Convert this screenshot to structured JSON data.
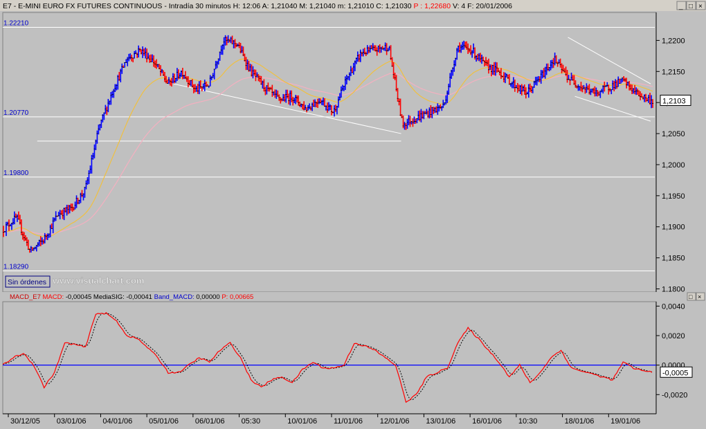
{
  "window": {
    "title_parts": [
      {
        "text": "E7 - E-MINI EURO FX FUTURES CONTINUOUS - Intradía 30 minutos ",
        "color": "#000000"
      },
      {
        "text": "H: 12:06 ",
        "color": "#000000"
      },
      {
        "text": "A: 1,21040 ",
        "color": "#000000"
      },
      {
        "text": "M: 1,21040 ",
        "color": "#000000"
      },
      {
        "text": "m: 1,21010 ",
        "color": "#000000"
      },
      {
        "text": "C: 1,21030 ",
        "color": "#000000"
      },
      {
        "text": "P : 1,22680 ",
        "color": "#ff0000"
      },
      {
        "text": "V: 4 ",
        "color": "#000000"
      },
      {
        "text": "F: 20/01/2006",
        "color": "#000000"
      }
    ],
    "buttons": [
      "_",
      "□",
      "×"
    ],
    "sub_buttons": [
      "□",
      "×"
    ]
  },
  "price_panel": {
    "ylim": [
      1.1795,
      1.2245
    ],
    "y_ticks": [
      {
        "value": 1.22,
        "label": "1,2200"
      },
      {
        "value": 1.215,
        "label": "1,2150"
      },
      {
        "value": 1.21,
        "label": "1,2100"
      },
      {
        "value": 1.205,
        "label": "1,2050"
      },
      {
        "value": 1.2,
        "label": "1,2000"
      },
      {
        "value": 1.195,
        "label": "1,1950"
      },
      {
        "value": 1.19,
        "label": "1,1900"
      },
      {
        "value": 1.185,
        "label": "1,1850"
      },
      {
        "value": 1.18,
        "label": "1,1800"
      }
    ],
    "levels": [
      {
        "value": 1.2221,
        "label": "1.22210"
      },
      {
        "value": 1.2077,
        "label": "1.20770"
      },
      {
        "value": 1.198,
        "label": "1.19800"
      },
      {
        "value": 1.1829,
        "label": "1.18290"
      }
    ],
    "last_value": "1,2103",
    "orders_label": "Sin órdenes",
    "watermark": "www.visualchart.com"
  },
  "macd_panel": {
    "header": [
      {
        "text": "MACD_E7 ",
        "color": "#cc0000"
      },
      {
        "text": "MACD: ",
        "color": "#ff0000"
      },
      {
        "text": "-0,00045 ",
        "color": "#000000"
      },
      {
        "text": "MediaSIG: ",
        "color": "#000000"
      },
      {
        "text": "-0,00041 ",
        "color": "#000000"
      },
      {
        "text": "Band_MACD: ",
        "color": "#0000cc"
      },
      {
        "text": "0,00000 ",
        "color": "#000000"
      },
      {
        "text": "P: 0,00665",
        "color": "#ff0000"
      }
    ],
    "ylim": [
      -0.0033,
      0.0043
    ],
    "y_ticks": [
      {
        "value": 0.004,
        "label": "0,0040"
      },
      {
        "value": 0.002,
        "label": "0,0020"
      },
      {
        "value": 0.0,
        "label": "0,0000"
      },
      {
        "value": -0.002,
        "label": "-0,0020"
      }
    ],
    "last_value": "-0,0005"
  },
  "x_axis": {
    "labels": [
      "30/12/05",
      "03/01/06",
      "04/01/06",
      "05/01/06",
      "06/01/06",
      "05:30",
      "10/01/06",
      "11/01/06",
      "12/01/06",
      "13/01/06",
      "16/01/06",
      "10:30",
      "18/01/06",
      "19/01/06"
    ]
  },
  "chart_data": [
    {
      "type": "line",
      "name": "E7 price (30 min bars, approximate)",
      "x": [
        0,
        20,
        40,
        60,
        80,
        100,
        120,
        140,
        160,
        180,
        200,
        220,
        240,
        260,
        280,
        300,
        320,
        340,
        360,
        380,
        400,
        420,
        440,
        460,
        480,
        500,
        520,
        540,
        560,
        580,
        600,
        620,
        640,
        660,
        680,
        700,
        720,
        740,
        760,
        780,
        800,
        820,
        840,
        860,
        880,
        900,
        920,
        940
      ],
      "values": [
        1.1895,
        1.1915,
        1.186,
        1.188,
        1.192,
        1.193,
        1.196,
        1.206,
        1.212,
        1.217,
        1.2185,
        1.2165,
        1.213,
        1.215,
        1.212,
        1.213,
        1.22,
        1.2195,
        1.215,
        1.2125,
        1.2105,
        1.211,
        1.209,
        1.2105,
        1.2085,
        1.214,
        1.218,
        1.2185,
        1.219,
        1.2065,
        1.2075,
        1.2085,
        1.2095,
        1.219,
        1.2185,
        1.216,
        1.215,
        1.213,
        1.2115,
        1.214,
        1.217,
        1.214,
        1.2125,
        1.2115,
        1.2125,
        1.2135,
        1.2115,
        1.2103
      ],
      "xlim": [
        0,
        948
      ],
      "ylim": [
        1.1795,
        1.2245
      ]
    },
    {
      "type": "line",
      "name": "MACD",
      "x": [
        0,
        15,
        30,
        45,
        60,
        75,
        90,
        105,
        120,
        135,
        150,
        165,
        180,
        195,
        210,
        225,
        240,
        255,
        270,
        285,
        300,
        315,
        330,
        345,
        360,
        375,
        390,
        405,
        420,
        435,
        450,
        465,
        480,
        495,
        510,
        525,
        540,
        555,
        570,
        585,
        600,
        615,
        630,
        645,
        660,
        675,
        690,
        705,
        720,
        735,
        750,
        765,
        780,
        795,
        810,
        825,
        840,
        855,
        870,
        885,
        900,
        915,
        930,
        945
      ],
      "values": [
        0.0,
        0.0005,
        0.0008,
        0.0,
        -0.0015,
        -0.0005,
        0.0015,
        0.0014,
        0.0012,
        0.0035,
        0.0035,
        0.003,
        0.002,
        0.0018,
        0.0012,
        0.0005,
        -0.0005,
        -0.0005,
        0.0,
        0.0005,
        0.0002,
        0.001,
        0.0015,
        0.0005,
        -0.001,
        -0.0015,
        -0.001,
        -0.0008,
        -0.0012,
        -0.0003,
        0.0002,
        -0.0002,
        -0.0002,
        0.0,
        0.0015,
        0.0013,
        0.001,
        0.0005,
        0.0,
        -0.0025,
        -0.002,
        -0.0008,
        -0.0005,
        -0.0002,
        0.0015,
        0.0025,
        0.0018,
        0.001,
        0.0002,
        -0.0008,
        0.0,
        -0.0012,
        -0.0005,
        0.0005,
        0.001,
        -0.0002,
        -0.0004,
        -0.0006,
        -0.0008,
        -0.001,
        0.0002,
        -0.0002,
        -0.0004,
        -0.0005
      ],
      "xlim": [
        0,
        948
      ],
      "ylim": [
        -0.0033,
        0.0043
      ]
    }
  ]
}
